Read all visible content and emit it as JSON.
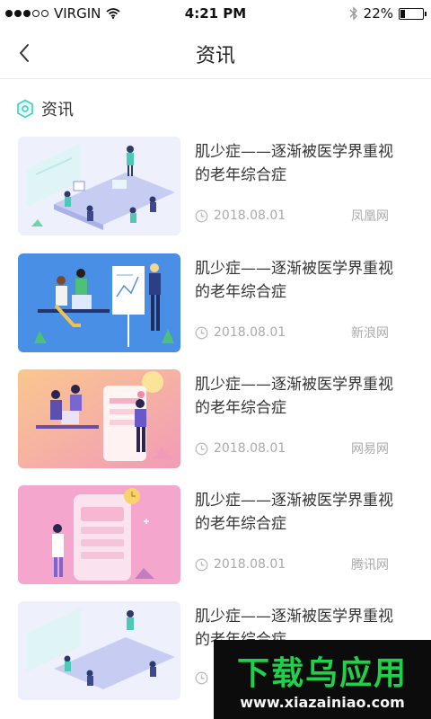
{
  "status_bar": {
    "carrier": "VIRGIN",
    "time": "4:21 PM",
    "battery": "22%",
    "battery_level": 0.22
  },
  "nav": {
    "title": "资讯",
    "back_icon": "chevron-left-icon"
  },
  "section": {
    "title": "资讯",
    "icon": "hexagon-icon",
    "accent": "#3ccfc2"
  },
  "articles": [
    {
      "title": "肌少症——逐渐被医学界重视的老年综合症",
      "date": "2018.08.01",
      "source": "凤凰网",
      "thumb": "office-meeting-illustration"
    },
    {
      "title": "肌少症——逐渐被医学界重视的老年综合症",
      "date": "2018.08.01",
      "source": "新浪网",
      "thumb": "presentation-illustration"
    },
    {
      "title": "肌少症——逐渐被医学界重视的老年综合症",
      "date": "2018.08.01",
      "source": "网易网",
      "thumb": "mobile-app-illustration"
    },
    {
      "title": "肌少症——逐渐被医学界重视的老年综合症",
      "date": "2018.08.01",
      "source": "腾讯网",
      "thumb": "phone-ui-illustration"
    },
    {
      "title": "肌少症——逐渐被医学界重视的老年综合症",
      "date": "",
      "source": "",
      "thumb": "office-meeting-illustration"
    }
  ],
  "watermark": {
    "main": "下载乌应用",
    "url": "www.xiazainiao.com"
  }
}
